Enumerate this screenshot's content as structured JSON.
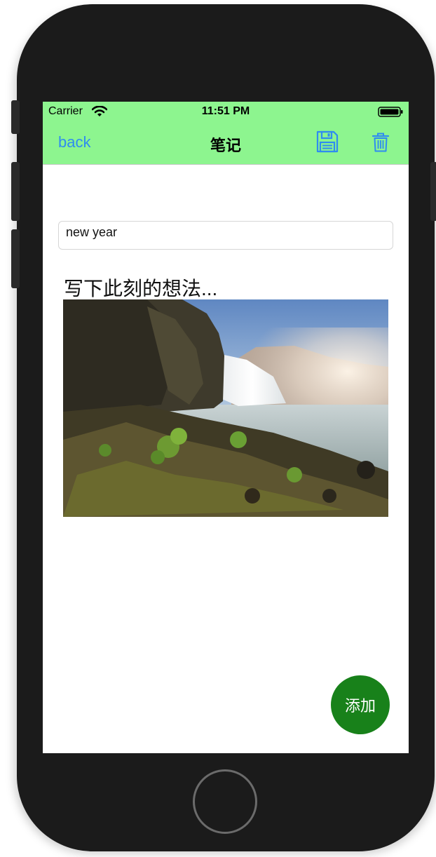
{
  "status_bar": {
    "carrier": "Carrier",
    "time": "11:51 PM",
    "icons": [
      "wifi-icon",
      "battery-icon"
    ]
  },
  "nav_bar": {
    "back_label": "back",
    "title": "笔记",
    "icons": [
      "save-icon",
      "trash-icon"
    ]
  },
  "note": {
    "title_value": "new year",
    "content_placeholder": "写下此刻的想法..."
  },
  "fab": {
    "add_label": "添加"
  },
  "colors": {
    "header_bg": "#8df58f",
    "link": "#2f8cf0",
    "fab_bg": "#18811a"
  }
}
